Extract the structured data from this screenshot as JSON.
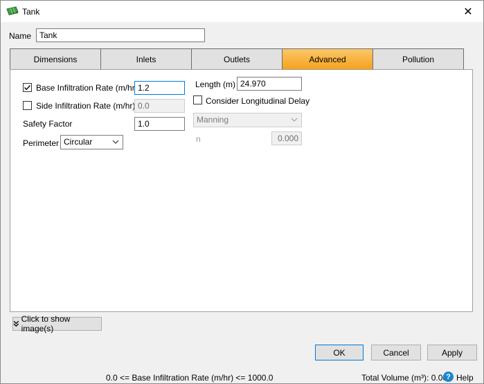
{
  "window": {
    "title": "Tank",
    "icon": "tank-app-icon",
    "close_glyph": "✕"
  },
  "name_field": {
    "label": "Name",
    "value": "Tank"
  },
  "tabs": [
    {
      "label": "Dimensions",
      "active": false
    },
    {
      "label": "Inlets",
      "active": false
    },
    {
      "label": "Outlets",
      "active": false
    },
    {
      "label": "Advanced",
      "active": true
    },
    {
      "label": "Pollution",
      "active": false
    }
  ],
  "advanced": {
    "base_infiltration": {
      "label": "Base Infiltration Rate (m/hr)",
      "checked": true,
      "value": "1.2"
    },
    "side_infiltration": {
      "label": "Side Infiltration Rate (m/hr)",
      "checked": false,
      "value": "0.0"
    },
    "safety_factor": {
      "label": "Safety Factor",
      "value": "1.0"
    },
    "perimeter": {
      "label": "Perimeter",
      "selected": "Circular"
    },
    "length": {
      "label": "Length (m)",
      "value": "24.970"
    },
    "longitudinal_delay": {
      "label": "Consider Longitudinal Delay",
      "checked": false
    },
    "friction_method": {
      "selected": "Manning"
    },
    "n_field": {
      "label": "n",
      "value": "0.000"
    }
  },
  "show_images_button": {
    "label": "Click to show image(s)"
  },
  "buttons": {
    "ok": "OK",
    "cancel": "Cancel",
    "apply": "Apply"
  },
  "status": {
    "constraint": "0.0 <= Base Infiltration Rate (m/hr) <= 1000.0",
    "total_volume": "Total Volume (m³): 0.000",
    "help": "Help"
  },
  "colors": {
    "active_tab": "#f4a21c",
    "focus_border": "#0078d7",
    "help_icon": "#1a86d0"
  }
}
